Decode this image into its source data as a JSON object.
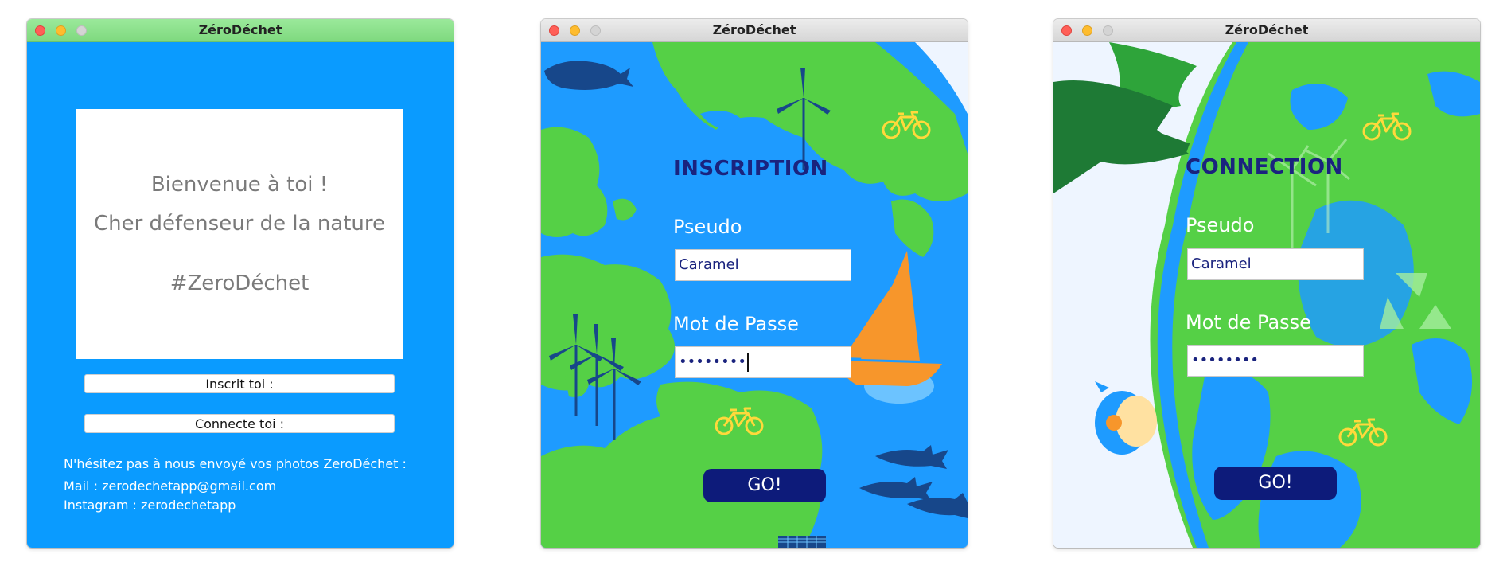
{
  "colors": {
    "ocean": "#1e9bff",
    "land": "#55d046",
    "heading": "#1a237e",
    "go_button": "#0d1b7a",
    "sail": "#f7962b",
    "bike": "#ffd93b",
    "welcome_bg": "#0a9bff"
  },
  "windows": [
    {
      "title": "ZéroDéchet",
      "welcome": {
        "line1": "Bienvenue à toi !",
        "line2": "Cher défenseur de la nature",
        "line3": "#ZeroDéchet"
      },
      "buttons": {
        "register": "Inscrit toi :",
        "login": "Connecte toi :"
      },
      "footer": {
        "line1": "N'hésitez pas à nous envoyé vos photos ZeroDéchet :",
        "mail": "Mail : zerodechetapp@gmail.com",
        "instagram": "Instagram : zerodechetapp"
      }
    },
    {
      "title": "ZéroDéchet",
      "heading": "INSCRIPTION",
      "pseudo_label": "Pseudo",
      "pseudo_value": "Caramel",
      "password_label": "Mot de Passe",
      "password_value": "••••••••",
      "go_label": "GO!"
    },
    {
      "title": "ZéroDéchet",
      "heading": "CONNECTION",
      "pseudo_label": "Pseudo",
      "pseudo_value": "Caramel",
      "password_label": "Mot de Passe",
      "password_value": "••••••••",
      "go_label": "GO!"
    }
  ]
}
